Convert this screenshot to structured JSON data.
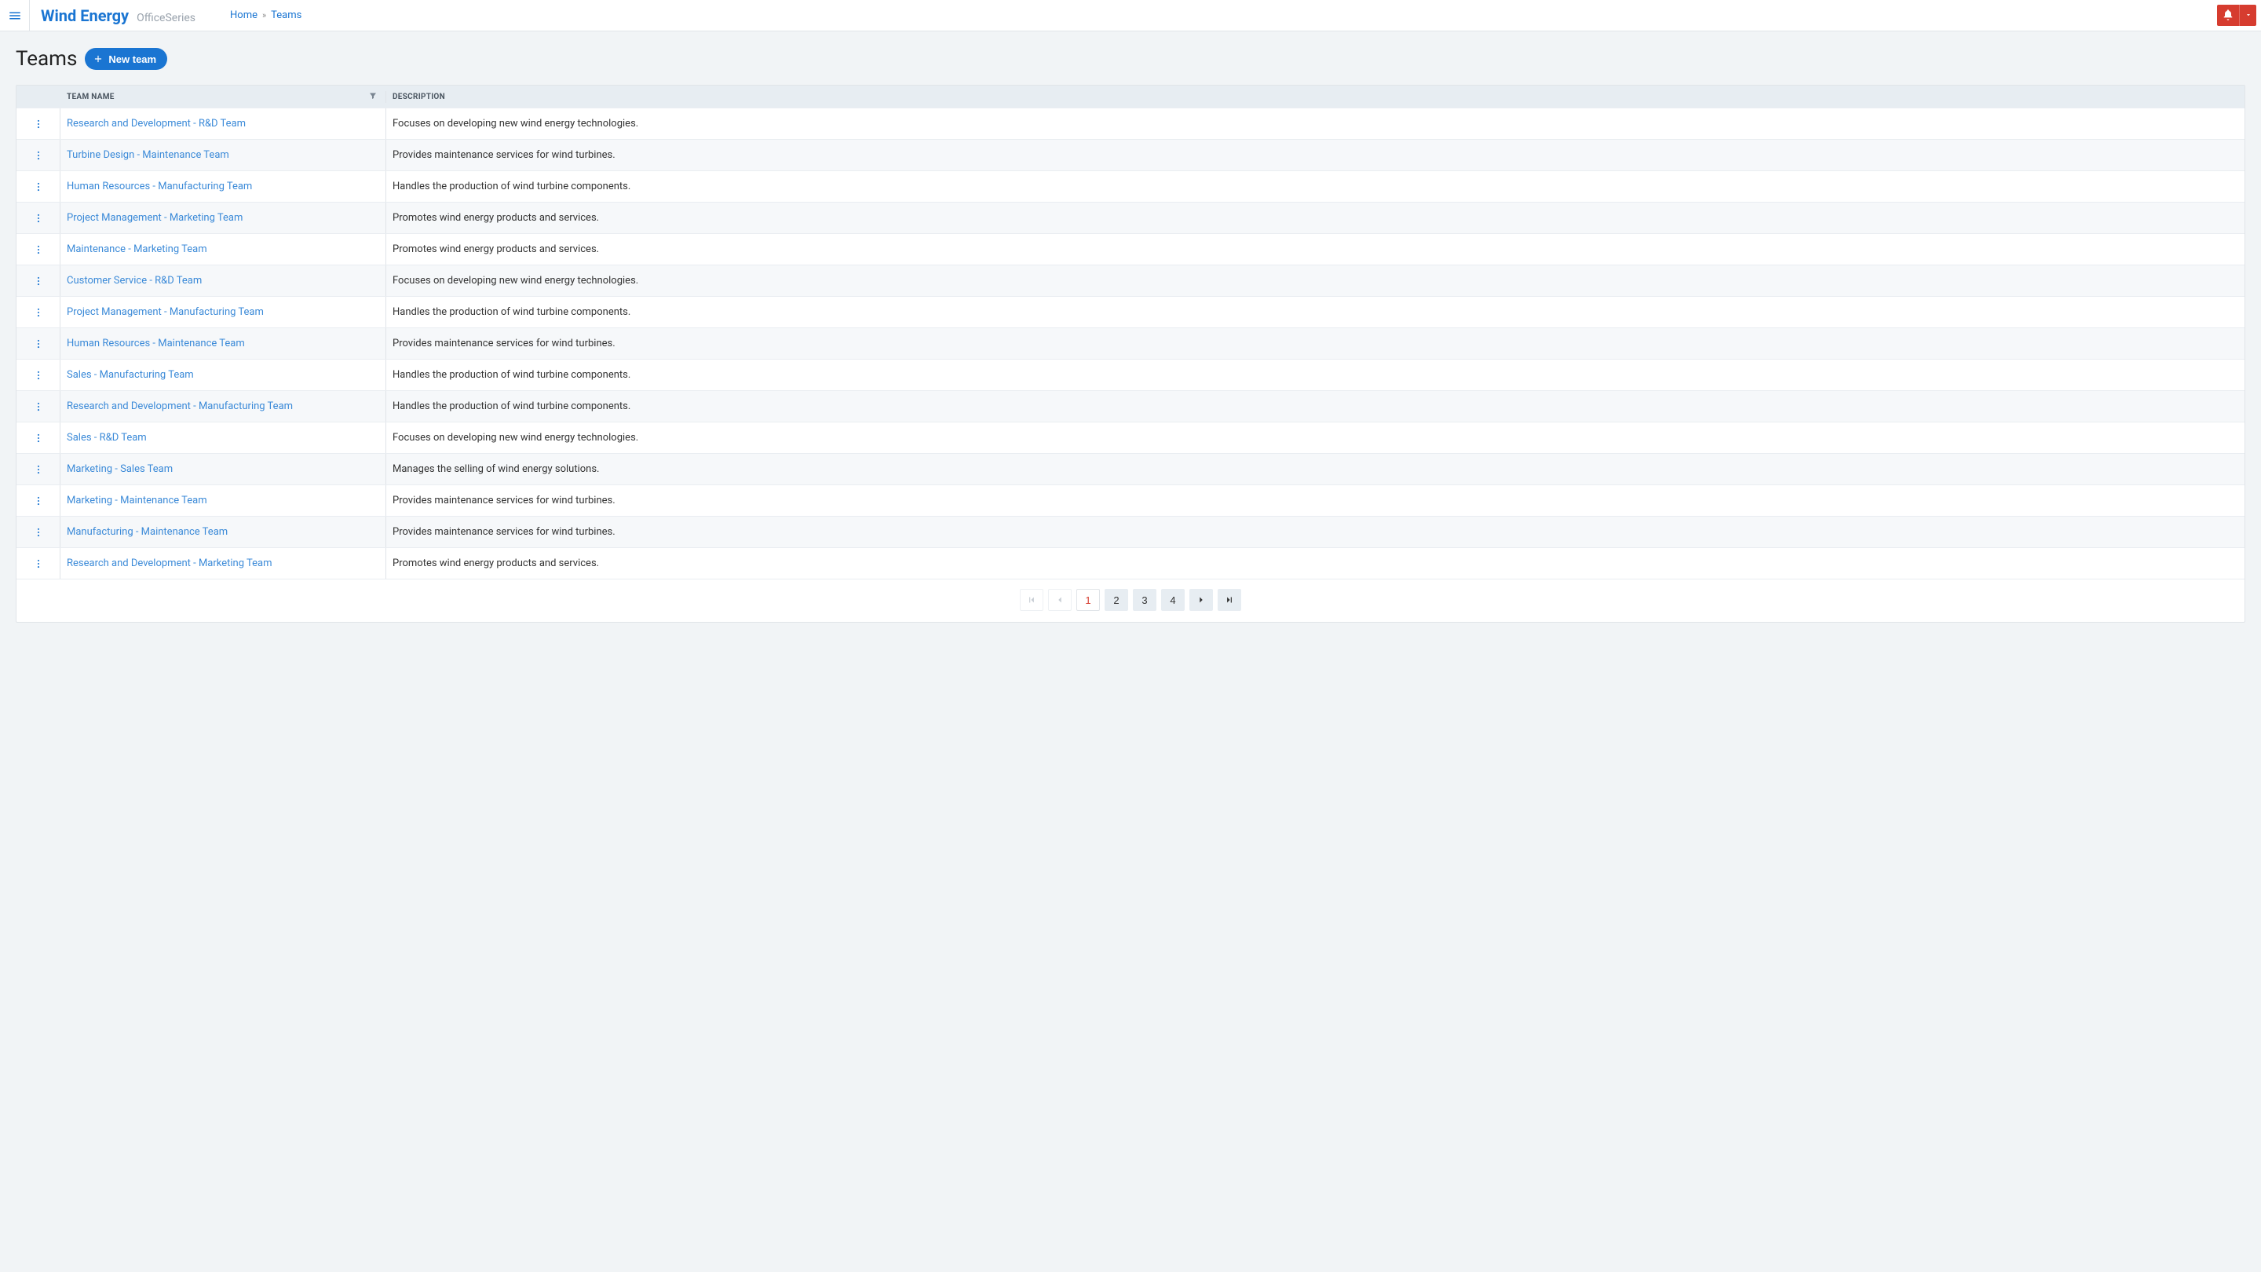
{
  "brand": {
    "name": "Wind Energy",
    "sub": "OfficeSeries"
  },
  "breadcrumb": {
    "home": "Home",
    "current": "Teams"
  },
  "page": {
    "title": "Teams",
    "new_btn": "New team"
  },
  "table": {
    "head": {
      "name": "TEAM NAME",
      "desc": "DESCRIPTION"
    },
    "rows": [
      {
        "name": "Research and Development - R&D Team",
        "desc": "Focuses on developing new wind energy technologies."
      },
      {
        "name": "Turbine Design - Maintenance Team",
        "desc": "Provides maintenance services for wind turbines."
      },
      {
        "name": "Human Resources - Manufacturing Team",
        "desc": "Handles the production of wind turbine components."
      },
      {
        "name": "Project Management - Marketing Team",
        "desc": "Promotes wind energy products and services."
      },
      {
        "name": "Maintenance - Marketing Team",
        "desc": "Promotes wind energy products and services."
      },
      {
        "name": "Customer Service - R&D Team",
        "desc": "Focuses on developing new wind energy technologies."
      },
      {
        "name": "Project Management - Manufacturing Team",
        "desc": "Handles the production of wind turbine components."
      },
      {
        "name": "Human Resources - Maintenance Team",
        "desc": "Provides maintenance services for wind turbines."
      },
      {
        "name": "Sales - Manufacturing Team",
        "desc": "Handles the production of wind turbine components."
      },
      {
        "name": "Research and Development - Manufacturing Team",
        "desc": "Handles the production of wind turbine components."
      },
      {
        "name": "Sales - R&D Team",
        "desc": "Focuses on developing new wind energy technologies."
      },
      {
        "name": "Marketing - Sales Team",
        "desc": "Manages the selling of wind energy solutions."
      },
      {
        "name": "Marketing - Maintenance Team",
        "desc": "Provides maintenance services for wind turbines."
      },
      {
        "name": "Manufacturing - Maintenance Team",
        "desc": "Provides maintenance services for wind turbines."
      },
      {
        "name": "Research and Development - Marketing Team",
        "desc": "Promotes wind energy products and services."
      }
    ]
  },
  "pagination": {
    "pages": [
      "1",
      "2",
      "3",
      "4"
    ],
    "current": 1
  }
}
